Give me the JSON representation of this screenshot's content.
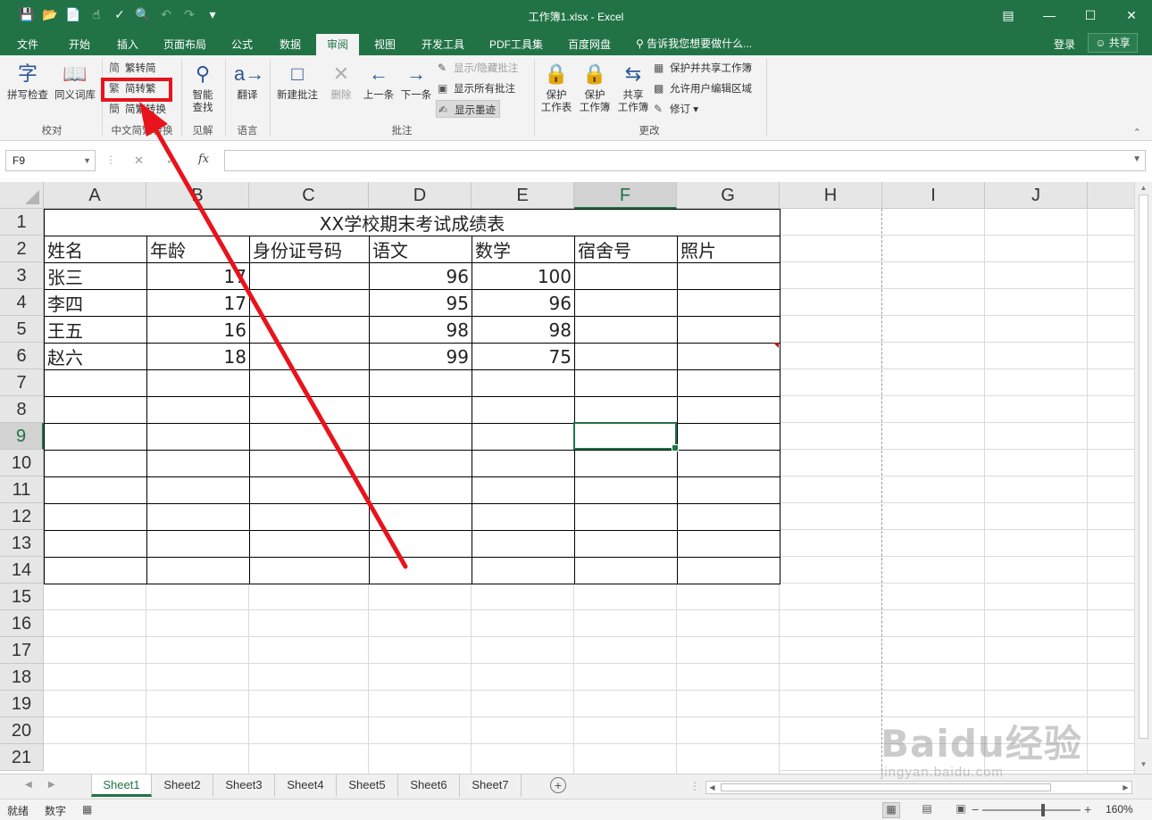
{
  "window": {
    "title": "工作簿1.xlsx - Excel",
    "controls": [
      "ribbon-options",
      "minimize",
      "maximize",
      "close"
    ]
  },
  "tabs": [
    "文件",
    "开始",
    "插入",
    "页面布局",
    "公式",
    "数据",
    "审阅",
    "视图",
    "开发工具",
    "PDF工具集",
    "百度网盘"
  ],
  "active_tab": "审阅",
  "tell_me": "告诉我您想要做什么...",
  "account": {
    "login": "登录",
    "share": "共享"
  },
  "ribbon": {
    "proofing": {
      "spell": "拼写检查",
      "thesaurus": "同义词库",
      "label": "校对"
    },
    "chinese": {
      "to_simplified": "繁转简",
      "to_traditional": "简转繁",
      "convert": "简繁转换",
      "label": "中文简繁转换"
    },
    "insights": {
      "smart_lookup_1": "智能",
      "smart_lookup_2": "查找",
      "label": "见解"
    },
    "language": {
      "translate": "翻译",
      "label": "语言"
    },
    "comments": {
      "new": "新建批注",
      "delete": "删除",
      "prev": "上一条",
      "next": "下一条",
      "show_hide": "显示/隐藏批注",
      "show_all": "显示所有批注",
      "show_ink": "显示墨迹",
      "label": "批注"
    },
    "changes": {
      "protect_sheet_1": "保护",
      "protect_sheet_2": "工作表",
      "protect_wb_1": "保护",
      "protect_wb_2": "工作簿",
      "share_wb_1": "共享",
      "share_wb_2": "工作簿",
      "protect_share": "保护并共享工作簿",
      "allow_edit": "允许用户编辑区域",
      "track": "修订",
      "label": "更改"
    }
  },
  "formula_bar": {
    "name_box": "F9",
    "fx": "fx",
    "value": ""
  },
  "columns": [
    "A",
    "B",
    "C",
    "D",
    "E",
    "F",
    "G",
    "H",
    "I",
    "J"
  ],
  "selected_column": "F",
  "rows": [
    "1",
    "2",
    "3",
    "4",
    "5",
    "6",
    "7",
    "8",
    "9",
    "10",
    "11",
    "12",
    "13",
    "14",
    "15",
    "16",
    "17",
    "18",
    "19",
    "20",
    "21"
  ],
  "selected_row": "9",
  "sheet_title": "XX学校期末考试成绩表",
  "table": {
    "headers": [
      "姓名",
      "年龄",
      "身份证号码",
      "语文",
      "数学",
      "宿舍号",
      "照片"
    ],
    "rows": [
      [
        "张三",
        "17",
        "",
        "96",
        "100",
        "",
        ""
      ],
      [
        "李四",
        "17",
        "",
        "95",
        "96",
        "",
        ""
      ],
      [
        "王五",
        "16",
        "",
        "98",
        "98",
        "",
        ""
      ],
      [
        "赵六",
        "18",
        "",
        "99",
        "75",
        "",
        ""
      ]
    ]
  },
  "sheets": [
    "Sheet1",
    "Sheet2",
    "Sheet3",
    "Sheet4",
    "Sheet5",
    "Sheet6",
    "Sheet7"
  ],
  "active_sheet": "Sheet1",
  "status": {
    "ready": "就绪",
    "mode": "数字",
    "zoom": "160%"
  },
  "watermark": {
    "brand": "Baidu经验",
    "url": "jingyan.baidu.com"
  },
  "colors": {
    "excel_green": "#217346",
    "highlight_red": "#e8131b"
  }
}
